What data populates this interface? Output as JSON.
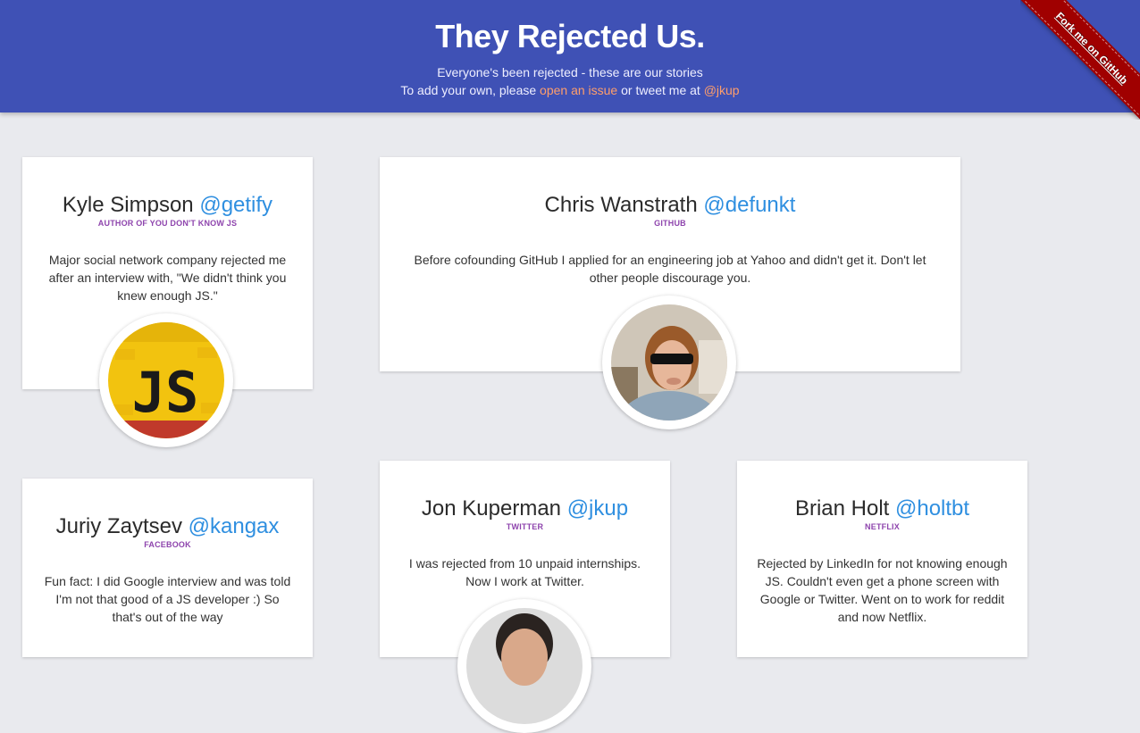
{
  "header": {
    "title": "They Rejected Us.",
    "subtitle": "Everyone's been rejected - these are our stories",
    "add_prefix": "To add your own, please ",
    "issue_link": "open an issue",
    "add_middle": " or tweet me at ",
    "twitter_link": "@jkup"
  },
  "ribbon": {
    "label": "Fork me on GitHub"
  },
  "colors": {
    "header_bg": "#3f51b5",
    "link_orange": "#ff9e6b",
    "handle_blue": "#2f8fe0",
    "role_purple": "#8e44ad",
    "ribbon_red": "#a00000"
  },
  "cards": [
    {
      "name": "Kyle Simpson",
      "handle": "@getify",
      "role": "AUTHOR OF YOU DON'T KNOW JS",
      "story": "Major social network company rejected me after an interview with, \"We didn't think you knew enough JS.\"",
      "avatar": "js-logo-avatar"
    },
    {
      "name": "Chris Wanstrath",
      "handle": "@defunkt",
      "role": "GITHUB",
      "story": "Before cofounding GitHub I applied for an engineering job at Yahoo and didn't get it. Don't let other people discourage you.",
      "avatar": "chris-wanstrath-photo"
    },
    {
      "name": "Juriy Zaytsev",
      "handle": "@kangax",
      "role": "FACEBOOK",
      "story": "Fun fact: I did Google interview and was told I'm not that good of a JS developer :) So that's out of the way",
      "avatar": "juriy-zaytsev-photo"
    },
    {
      "name": "Jon Kuperman",
      "handle": "@jkup",
      "role": "TWITTER",
      "story": "I was rejected from 10 unpaid internships. Now I work at Twitter.",
      "avatar": "jon-kuperman-photo"
    },
    {
      "name": "Brian Holt",
      "handle": "@holtbt",
      "role": "NETFLIX",
      "story": "Rejected by LinkedIn for not knowing enough JS. Couldn't even get a phone screen with Google or Twitter. Went on to work for reddit and now Netflix.",
      "avatar": "brian-holt-photo"
    }
  ]
}
